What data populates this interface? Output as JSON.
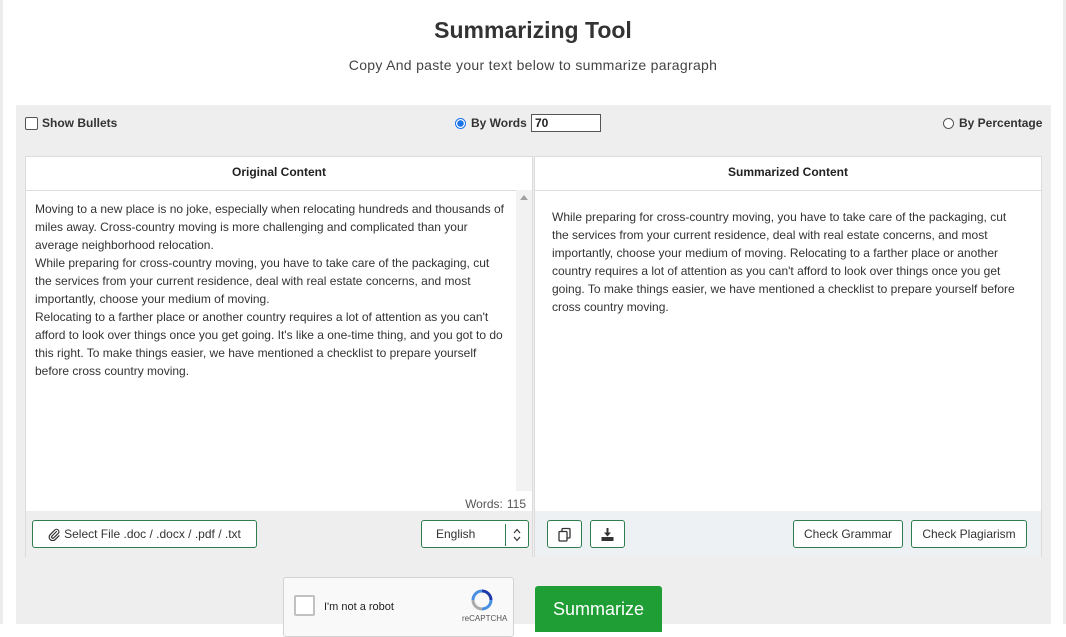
{
  "header": {
    "title": "Summarizing Tool",
    "subtitle": "Copy And paste your text below to summarize paragraph"
  },
  "options": {
    "show_bullets_label": "Show Bullets",
    "show_bullets_checked": false,
    "by_words_label": "By Words",
    "by_words_selected": true,
    "by_words_value": "70",
    "by_percentage_label": "By Percentage",
    "by_percentage_selected": false
  },
  "original": {
    "heading": "Original Content",
    "paragraphs": [
      "Moving to a new place is no joke, especially when relocating hundreds and thousands of miles away. Cross-country moving is more challenging and complicated than your average neighborhood relocation.",
      "While preparing for cross-country moving, you have to take care of the packaging, cut the services from your current residence, deal with real estate concerns, and most importantly, choose your medium of moving.",
      "Relocating to a farther place or another country requires a lot of attention as you can't afford to look over things once you get going. It's like a one-time thing, and you got to do this right. To make things easier, we have mentioned a checklist to prepare yourself before cross country moving."
    ],
    "word_count_label": "Words:",
    "word_count": "115",
    "select_file_label": "Select File .doc / .docx / .pdf / .txt",
    "language": "English"
  },
  "summarized": {
    "heading": "Summarized Content",
    "text": "While preparing for cross-country moving, you have to take care of the packaging, cut the services from your current residence, deal with real estate concerns, and most importantly, choose your medium of moving. Relocating to a farther place or another country requires a lot of attention as you can't afford to look over things once you get going. To make things easier, we have mentioned a checklist to prepare yourself before cross country moving.",
    "check_grammar_label": "Check Grammar",
    "check_plagiarism_label": "Check Plagiarism"
  },
  "captcha": {
    "label": "I'm not a robot",
    "brand": "reCAPTCHA"
  },
  "summarize_button": "Summarize",
  "colors": {
    "accent_green": "#1e9e34",
    "button_border": "#2e7d4f",
    "radio_blue": "#1a73e8",
    "panel_bg": "#eeeeee"
  },
  "icons": [
    "paperclip-icon",
    "chevron-up-icon",
    "chevron-down-icon",
    "copy-icon",
    "download-icon",
    "recaptcha-logo-icon"
  ]
}
